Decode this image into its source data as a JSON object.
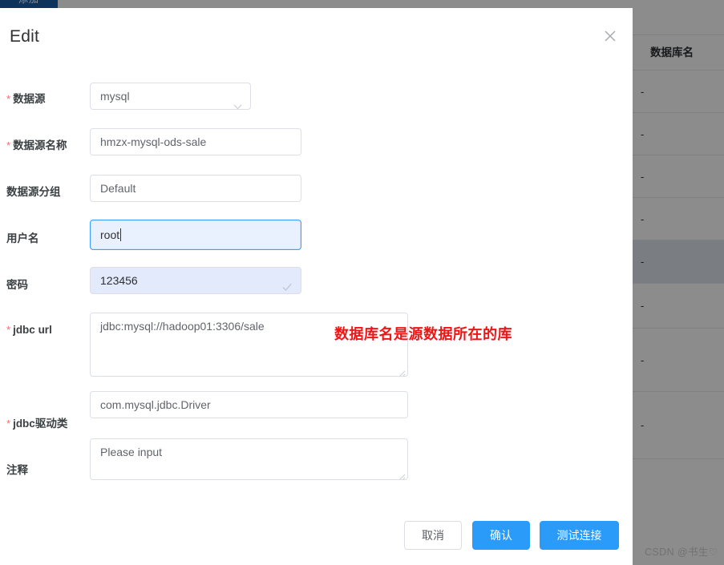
{
  "background": {
    "add_button_label": "添加",
    "table": {
      "column_header": "数据库名",
      "rows": [
        {
          "value": "-",
          "selected": false
        },
        {
          "value": "-",
          "selected": false
        },
        {
          "value": "-",
          "selected": false
        },
        {
          "value": "-",
          "selected": false
        },
        {
          "value": "-",
          "selected": true
        },
        {
          "value": "-",
          "selected": false
        },
        {
          "value": "-",
          "selected": false
        },
        {
          "value": "-",
          "selected": false
        }
      ]
    },
    "watermark": "CSDN @书生♡"
  },
  "modal": {
    "title": "Edit",
    "close_icon": "close-icon",
    "fields": {
      "datasource": {
        "label": "数据源",
        "required": true,
        "value": "mysql",
        "type": "select",
        "chevron_icon": "chevron-down-icon"
      },
      "datasource_name": {
        "label": "数据源名称",
        "required": true,
        "value": "hmzx-mysql-ods-sale",
        "type": "input"
      },
      "datasource_group": {
        "label": "数据源分组",
        "required": false,
        "value": "Default",
        "type": "input"
      },
      "username": {
        "label": "用户名",
        "required": false,
        "value": "root",
        "type": "input",
        "focused": true
      },
      "password": {
        "label": "密码",
        "required": false,
        "value": "123456",
        "type": "password",
        "autofilled": true,
        "check_icon": "check-icon"
      },
      "jdbc_url": {
        "label": "jdbc url",
        "required": true,
        "value": "jdbc:mysql://hadoop01:3306/sale",
        "type": "textarea"
      },
      "jdbc_driver": {
        "label": "jdbc驱动类",
        "required": true,
        "value": "com.mysql.jdbc.Driver",
        "type": "input"
      },
      "comment": {
        "label": "注释",
        "required": false,
        "value": "",
        "placeholder": "Please input",
        "type": "textarea"
      }
    },
    "annotation": "数据库名是源数据所在的库",
    "buttons": {
      "cancel": "取消",
      "confirm": "确认",
      "test_connection": "测试连接"
    }
  },
  "colors": {
    "primary": "#2b9bfa",
    "required_star": "#f56c6c",
    "annotation_red": "#f01414",
    "focus_border": "#409eff",
    "autofill_bg": "#e3eafb"
  }
}
